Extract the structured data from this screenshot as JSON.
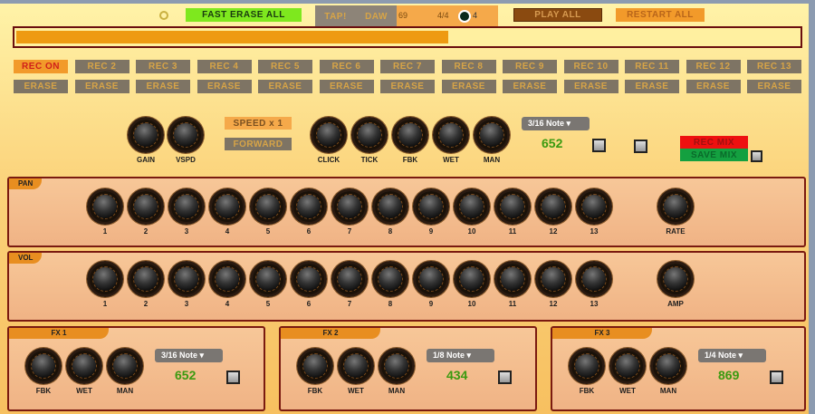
{
  "topbar": {
    "fast_erase": "FAST ERASE ALL",
    "tap": "TAP!",
    "daw": "DAW",
    "bpm": "69",
    "time_sig": "4/4",
    "beat": "4",
    "play_all": "PLAY ALL",
    "restart_all": "RESTART ALL"
  },
  "progress": {
    "fraction": 0.55,
    "color": "#ee9a12"
  },
  "rec_buttons": [
    "REC ON",
    "REC 2",
    "REC 3",
    "REC 4",
    "REC 5",
    "REC 6",
    "REC 7",
    "REC 8",
    "REC 9",
    "REC 10",
    "REC 11",
    "REC 12",
    "REC 13"
  ],
  "erase_label": "ERASE",
  "controls": {
    "gain": "GAIN",
    "vspd": "VSPD",
    "speed": "SPEED x 1",
    "direction": "FORWARD",
    "click": "CLICK",
    "tick": "TICK",
    "fbk": "FBK",
    "wet": "WET",
    "man": "MAN",
    "note": "3/16 Note",
    "delay_value": "652",
    "rec_mix": "REC MIX",
    "save_mix": "SAVE MIX"
  },
  "pan": {
    "title": "PAN",
    "labels": [
      "1",
      "2",
      "3",
      "4",
      "5",
      "6",
      "7",
      "8",
      "9",
      "10",
      "11",
      "12",
      "13"
    ],
    "extra": "RATE"
  },
  "vol": {
    "title": "VOL",
    "labels": [
      "1",
      "2",
      "3",
      "4",
      "5",
      "6",
      "7",
      "8",
      "9",
      "10",
      "11",
      "12",
      "13"
    ],
    "extra": "AMP"
  },
  "fx": [
    {
      "title": "FX 1",
      "note": "3/16 Note",
      "value": "652",
      "knobs": [
        "FBK",
        "WET",
        "MAN"
      ]
    },
    {
      "title": "FX 2",
      "note": "1/8 Note",
      "value": "434",
      "knobs": [
        "FBK",
        "WET",
        "MAN"
      ]
    },
    {
      "title": "FX 3",
      "note": "1/4 Note",
      "value": "869",
      "knobs": [
        "FBK",
        "WET",
        "MAN"
      ]
    }
  ],
  "colors": {
    "rec_on": "#f29a2a",
    "fast_erase": "#7ee81e",
    "play_all": "#8a4a10",
    "rec_mix": "#ee1010",
    "save_mix": "#14a040"
  }
}
